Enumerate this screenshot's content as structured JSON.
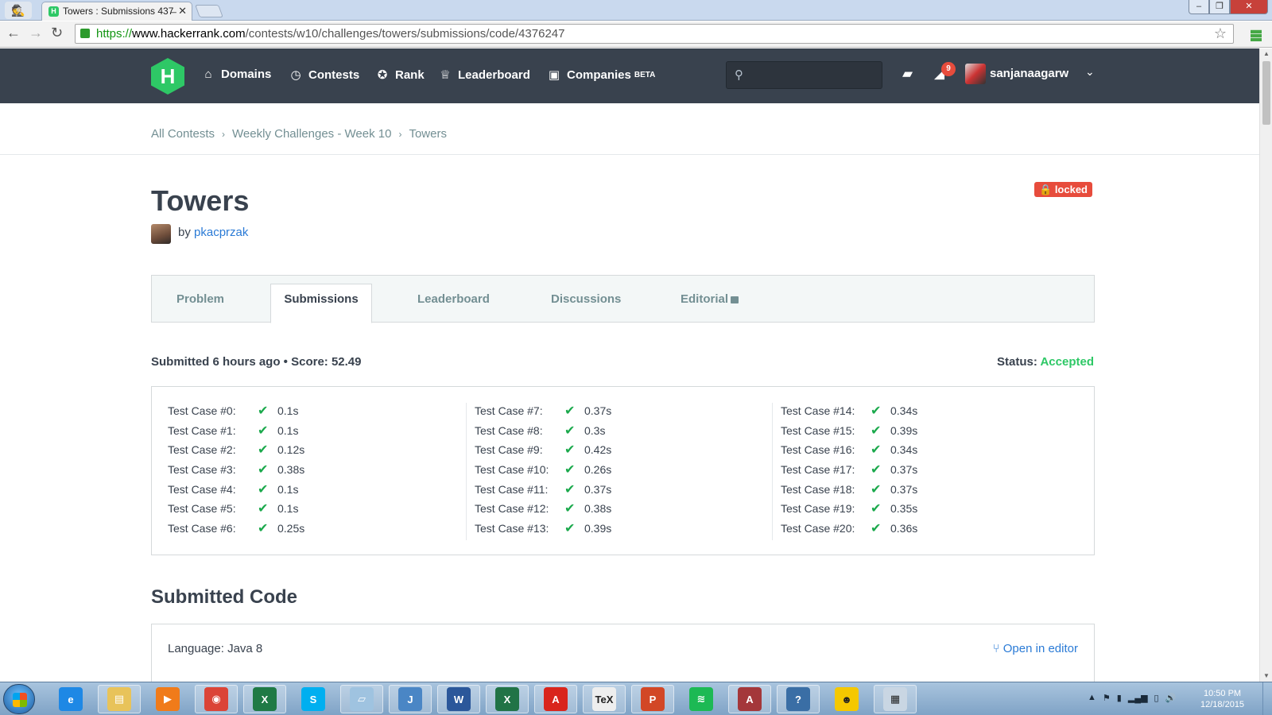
{
  "browser": {
    "tab_title": "Towers : Submissions 437̶",
    "url_scheme": "https://",
    "url_host": "www.hackerrank.com",
    "url_path": "/contests/w10/challenges/towers/submissions/code/4376247"
  },
  "topnav": {
    "items": [
      {
        "label": "Domains",
        "icon": "home-icon"
      },
      {
        "label": "Contests",
        "icon": "clock-icon"
      },
      {
        "label": "Rank",
        "icon": "medal-icon"
      },
      {
        "label": "Leaderboard",
        "icon": "trophy-icon"
      },
      {
        "label": "Companies",
        "icon": "briefcase-icon",
        "badge": "BETA"
      }
    ],
    "notification_count": "9",
    "username": "sanjanaagarw"
  },
  "breadcrumb": [
    "All Contests",
    "Weekly Challenges - Week 10",
    "Towers"
  ],
  "challenge": {
    "title": "Towers",
    "locked_label": "locked",
    "by_label": "by",
    "author": "pkacprzak"
  },
  "tabs": [
    "Problem",
    "Submissions",
    "Leaderboard",
    "Discussions",
    "Editorial"
  ],
  "submission": {
    "info": "Submitted 6 hours ago • Score: 52.49",
    "status_label": "Status:",
    "status_value": "Accepted",
    "status_color": "#2ec866"
  },
  "test_cases": [
    [
      {
        "label": "Test Case #0:",
        "time": "0.1s"
      },
      {
        "label": "Test Case #1:",
        "time": "0.1s"
      },
      {
        "label": "Test Case #2:",
        "time": "0.12s"
      },
      {
        "label": "Test Case #3:",
        "time": "0.38s"
      },
      {
        "label": "Test Case #4:",
        "time": "0.1s"
      },
      {
        "label": "Test Case #5:",
        "time": "0.1s"
      },
      {
        "label": "Test Case #6:",
        "time": "0.25s"
      }
    ],
    [
      {
        "label": "Test Case #7:",
        "time": "0.37s"
      },
      {
        "label": "Test Case #8:",
        "time": "0.3s"
      },
      {
        "label": "Test Case #9:",
        "time": "0.42s"
      },
      {
        "label": "Test Case #10:",
        "time": "0.26s"
      },
      {
        "label": "Test Case #11:",
        "time": "0.37s"
      },
      {
        "label": "Test Case #12:",
        "time": "0.38s"
      },
      {
        "label": "Test Case #13:",
        "time": "0.39s"
      }
    ],
    [
      {
        "label": "Test Case #14:",
        "time": "0.34s"
      },
      {
        "label": "Test Case #15:",
        "time": "0.39s"
      },
      {
        "label": "Test Case #16:",
        "time": "0.34s"
      },
      {
        "label": "Test Case #17:",
        "time": "0.37s"
      },
      {
        "label": "Test Case #18:",
        "time": "0.37s"
      },
      {
        "label": "Test Case #19:",
        "time": "0.35s"
      },
      {
        "label": "Test Case #20:",
        "time": "0.36s"
      }
    ]
  ],
  "code_section": {
    "heading": "Submitted Code",
    "language": "Language: Java 8",
    "open_editor": "Open in editor"
  },
  "taskbar": {
    "apps": [
      "internet-explorer",
      "file-explorer",
      "media-player",
      "chrome",
      "excel-csv",
      "skype",
      "notepad",
      "jcreator",
      "word",
      "excel",
      "acrobat",
      "tex",
      "powerpoint",
      "spotify",
      "access",
      "help",
      "cyberghost",
      "calculator"
    ],
    "time": "10:50 PM",
    "date": "12/18/2015"
  }
}
